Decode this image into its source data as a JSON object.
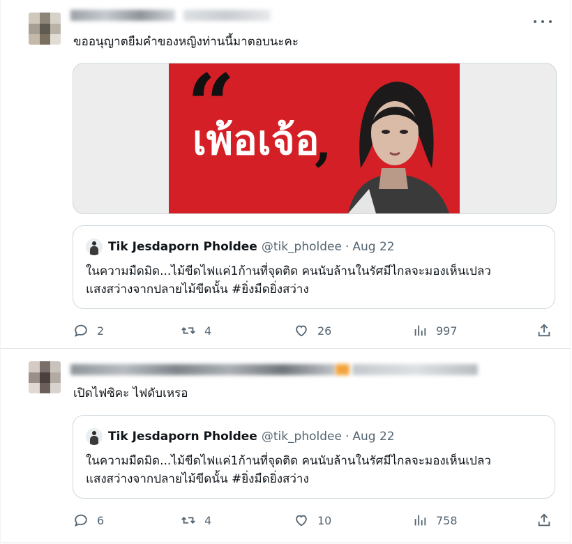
{
  "tweets": [
    {
      "text": "ขออนุญาตยืมคำของหญิงท่านนี้มาตอบนะคะ",
      "media": {
        "quote_open": "“",
        "poster_text": "เพ้อเจ้อ",
        "quote_close": "”"
      },
      "quoted": {
        "name": "Tik Jesdaporn Pholdee",
        "handle": "@tik_pholdee",
        "dot": "·",
        "date": "Aug 22",
        "line1": "ในความมืดมิด...ไม้ขีดไฟแค่1ก้านที่จุดติด คนนับล้านในรัศมีไกลจะมองเห็นเปลว",
        "line2": "แสงสว่างจากปลายไม้ขีดนั้น #ยิ่งมืดยิ่งสว่าง"
      },
      "actions": {
        "replies": "2",
        "retweets": "4",
        "likes": "26",
        "views": "997"
      }
    },
    {
      "text": "เปิดไฟซิคะ ไฟดับเหรอ",
      "quoted": {
        "name": "Tik Jesdaporn Pholdee",
        "handle": "@tik_pholdee",
        "dot": "·",
        "date": "Aug 22",
        "line1": "ในความมืดมิด...ไม้ขีดไฟแค่1ก้านที่จุดติด คนนับล้านในรัศมีไกลจะมองเห็นเปลว",
        "line2": "แสงสว่างจากปลายไม้ขีดนั้น #ยิ่งมืดยิ่งสว่าง"
      },
      "actions": {
        "replies": "6",
        "retweets": "4",
        "likes": "10",
        "views": "758"
      }
    }
  ],
  "icons": [
    "reply-icon",
    "retweet-icon",
    "like-icon",
    "views-icon",
    "share-icon",
    "more-icon"
  ],
  "colors": {
    "poster_red": "#d51f26",
    "text_secondary": "#536471",
    "border": "#cfd9de"
  }
}
